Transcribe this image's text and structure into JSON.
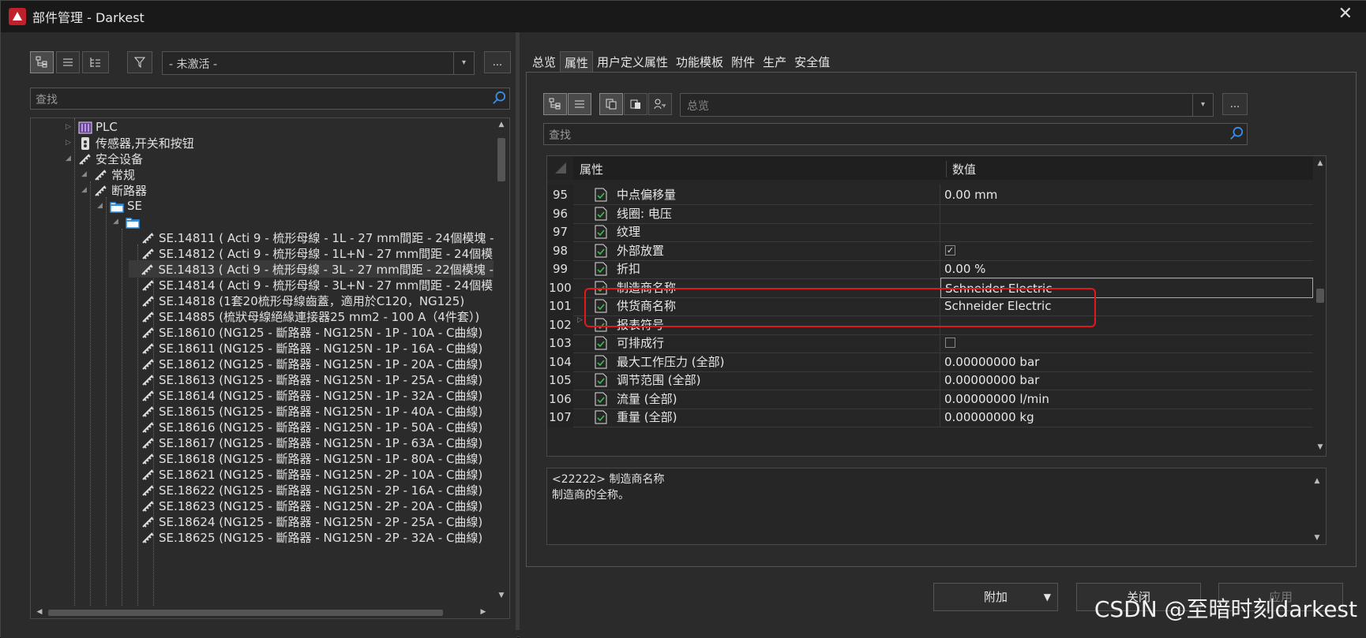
{
  "window": {
    "title": "部件管理 - Darkest",
    "close": "✕"
  },
  "left": {
    "filter_value": "- 未激活 -",
    "more": "...",
    "search_placeholder": "查找",
    "tree": [
      {
        "label": "PLC",
        "indent": 2,
        "icon": "plc-icon"
      },
      {
        "label": "传感器,开关和按钮",
        "indent": 2,
        "icon": "sensor-icon"
      },
      {
        "label": "安全设备",
        "indent": 2,
        "icon": "part-icon"
      },
      {
        "label": "常规",
        "indent": 3,
        "icon": "part-icon"
      },
      {
        "label": "断路器",
        "indent": 3,
        "icon": "part-icon"
      },
      {
        "label": "SE",
        "indent": 4,
        "icon": "folder-icon"
      },
      {
        "label": "",
        "indent": 5,
        "icon": "folder-icon"
      },
      {
        "label": "SE.14811 ( Acti 9 - 梳形母線 - 1L - 27 mm間距 - 24個模塊 -",
        "indent": 6,
        "icon": "part-icon"
      },
      {
        "label": "SE.14812 ( Acti 9 - 梳形母線 - 1L+N - 27 mm間距 - 24個模",
        "indent": 6,
        "icon": "part-icon"
      },
      {
        "label": "SE.14813 ( Acti 9 - 梳形母線 - 3L - 27 mm間距 - 22個模塊 -",
        "indent": 6,
        "icon": "part-icon",
        "selected": true
      },
      {
        "label": "SE.14814 ( Acti 9 - 梳形母線 - 3L+N - 27 mm間距 - 24個模",
        "indent": 6,
        "icon": "part-icon"
      },
      {
        "label": "SE.14818 (1套20梳形母線齒蓋，適用於C120，NG125)",
        "indent": 6,
        "icon": "part-icon"
      },
      {
        "label": "SE.14885 (梳狀母線絕緣連接器25 mm2 - 100 A（4件套）)",
        "indent": 6,
        "icon": "part-icon"
      },
      {
        "label": "SE.18610 (NG125 - 斷路器 - NG125N - 1P - 10A - C曲線)",
        "indent": 6,
        "icon": "part-icon"
      },
      {
        "label": "SE.18611 (NG125 - 斷路器 - NG125N - 1P - 16A - C曲線)",
        "indent": 6,
        "icon": "part-icon"
      },
      {
        "label": "SE.18612 (NG125 - 斷路器 - NG125N - 1P - 20A - C曲線)",
        "indent": 6,
        "icon": "part-icon"
      },
      {
        "label": "SE.18613 (NG125 - 斷路器 - NG125N - 1P - 25A - C曲線)",
        "indent": 6,
        "icon": "part-icon"
      },
      {
        "label": "SE.18614 (NG125 - 斷路器 - NG125N - 1P - 32A - C曲線)",
        "indent": 6,
        "icon": "part-icon"
      },
      {
        "label": "SE.18615 (NG125 - 斷路器 - NG125N - 1P - 40A - C曲線)",
        "indent": 6,
        "icon": "part-icon"
      },
      {
        "label": "SE.18616 (NG125 - 斷路器 - NG125N - 1P - 50A - C曲線)",
        "indent": 6,
        "icon": "part-icon"
      },
      {
        "label": "SE.18617 (NG125 - 斷路器 - NG125N - 1P - 63A - C曲線)",
        "indent": 6,
        "icon": "part-icon"
      },
      {
        "label": "SE.18618 (NG125 - 斷路器 - NG125N - 1P - 80A - C曲線)",
        "indent": 6,
        "icon": "part-icon"
      },
      {
        "label": "SE.18621 (NG125 - 斷路器 - NG125N - 2P - 10A - C曲線)",
        "indent": 6,
        "icon": "part-icon"
      },
      {
        "label": "SE.18622 (NG125 - 斷路器 - NG125N - 2P - 16A - C曲線)",
        "indent": 6,
        "icon": "part-icon"
      },
      {
        "label": "SE.18623 (NG125 - 斷路器 - NG125N - 2P - 20A - C曲線)",
        "indent": 6,
        "icon": "part-icon"
      },
      {
        "label": "SE.18624 (NG125 - 斷路器 - NG125N - 2P - 25A - C曲線)",
        "indent": 6,
        "icon": "part-icon"
      },
      {
        "label": "SE.18625 (NG125 - 斷路器 - NG125N - 2P - 32A - C曲線)",
        "indent": 6,
        "icon": "part-icon"
      }
    ]
  },
  "right": {
    "tabs": [
      "总览",
      "属性",
      "用户定义属性",
      "功能模板",
      "附件",
      "生产",
      "安全值"
    ],
    "active_tab": 1,
    "view_combo": "总览",
    "more": "...",
    "search_placeholder": "查找",
    "grid": {
      "col_property": "属性",
      "col_value": "数值",
      "rows": [
        {
          "num": "95",
          "name": "中点偏移量",
          "value": "0.00 mm"
        },
        {
          "num": "96",
          "name": "线圈: 电压",
          "value": ""
        },
        {
          "num": "97",
          "name": "纹理",
          "value": ""
        },
        {
          "num": "98",
          "name": "外部放置",
          "value": "",
          "checkbox": true,
          "checked": true
        },
        {
          "num": "99",
          "name": "折扣",
          "value": "0.00 %"
        },
        {
          "num": "100",
          "name": "制造商名称",
          "value": "Schneider Electric",
          "highlight": true
        },
        {
          "num": "101",
          "name": "供货商名称",
          "value": "Schneider Electric",
          "highlight": true
        },
        {
          "num": "102",
          "name": "报表符号",
          "value": "",
          "expandable": true
        },
        {
          "num": "103",
          "name": "可排成行",
          "value": "",
          "checkbox": true,
          "checked": false
        },
        {
          "num": "104",
          "name": "最大工作压力 (全部)",
          "value": "0.00000000 bar"
        },
        {
          "num": "105",
          "name": "调节范围 (全部)",
          "value": "0.00000000 bar"
        },
        {
          "num": "106",
          "name": "流量 (全部)",
          "value": "0.00000000 l/min"
        },
        {
          "num": "107",
          "name": "重量 (全部)",
          "value": "0.00000000 kg"
        }
      ]
    },
    "description": {
      "line1": "<22222> 制造商名称",
      "line2": "制造商的全称。"
    },
    "buttons": {
      "attach": "附加",
      "close": "关闭",
      "apply": "应用"
    }
  },
  "watermark": "CSDN @至暗时刻darkest",
  "colors": {
    "highlight": "#e0191f",
    "background": "#2b2b2b",
    "check": "#3fb950"
  }
}
